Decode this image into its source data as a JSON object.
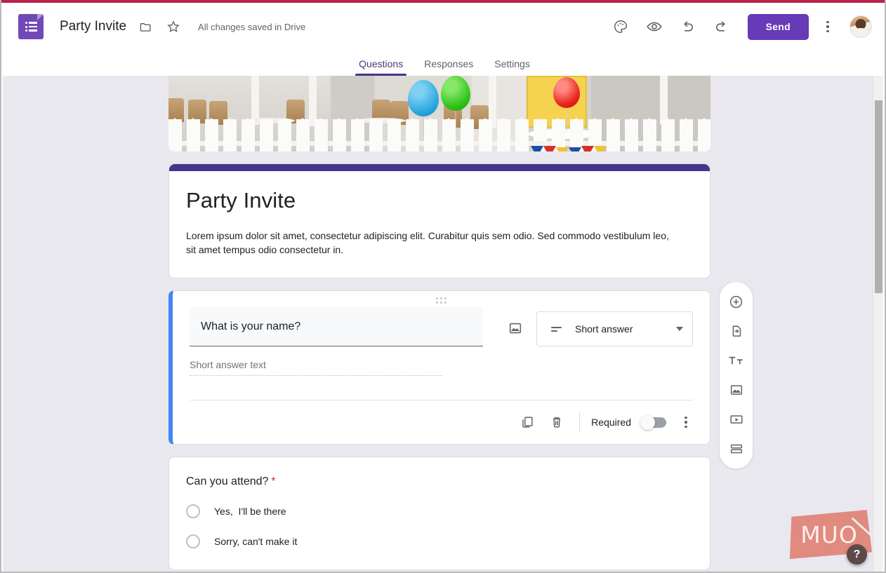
{
  "app": {
    "logo_icon": "google-forms-icon",
    "doc_title": "Party Invite",
    "folder_icon": "folder-icon",
    "star_icon": "star-icon",
    "save_status": "All changes saved in Drive",
    "theme_icon": "palette-icon",
    "preview_icon": "eye-icon",
    "undo_icon": "undo-icon",
    "redo_icon": "redo-icon",
    "send_label": "Send",
    "more_icon": "kebab-menu-icon",
    "avatar_icon": "user-avatar"
  },
  "tabs": [
    {
      "label": "Questions",
      "active": true
    },
    {
      "label": "Responses",
      "active": false
    },
    {
      "label": "Settings",
      "active": false
    }
  ],
  "banner": {
    "alt": "party-banner-image",
    "accent_color": "#45348a"
  },
  "form_header": {
    "title": "Party Invite",
    "description": "Lorem ipsum dolor sit amet, consectetur adipiscing elit. Curabitur quis sem odio. Sed commodo vestibulum leo, sit amet tempus odio consectetur in."
  },
  "question_card": {
    "drag_handle_icon": "drag-handle-icon",
    "title": "What is your name?",
    "image_icon": "add-image-icon",
    "type_icon": "short-answer-icon",
    "type_value": "Short answer",
    "caret_icon": "chevron-down-icon",
    "answer_placeholder": "Short answer text",
    "duplicate_icon": "duplicate-icon",
    "delete_icon": "trash-icon",
    "required_label": "Required",
    "required_value": "off",
    "more_icon": "kebab-menu-icon",
    "accent_color": "#4285f4"
  },
  "radio_card": {
    "title": "Can you attend?",
    "required_marker": "*",
    "options": [
      {
        "label": "Yes,  I'll be there",
        "icon": "radio-unchecked-icon"
      },
      {
        "label": "Sorry, can't make it",
        "icon": "radio-unchecked-icon"
      }
    ]
  },
  "side_toolbar": [
    {
      "name": "add-question",
      "icon": "plus-circle-icon"
    },
    {
      "name": "import-questions",
      "icon": "import-file-icon"
    },
    {
      "name": "add-title-description",
      "icon": "title-text-icon"
    },
    {
      "name": "add-image",
      "icon": "image-icon"
    },
    {
      "name": "add-video",
      "icon": "video-icon"
    },
    {
      "name": "add-section",
      "icon": "section-icon"
    }
  ],
  "watermark": {
    "text": "MUO",
    "color": "#e08a80",
    "help_label": "?"
  }
}
